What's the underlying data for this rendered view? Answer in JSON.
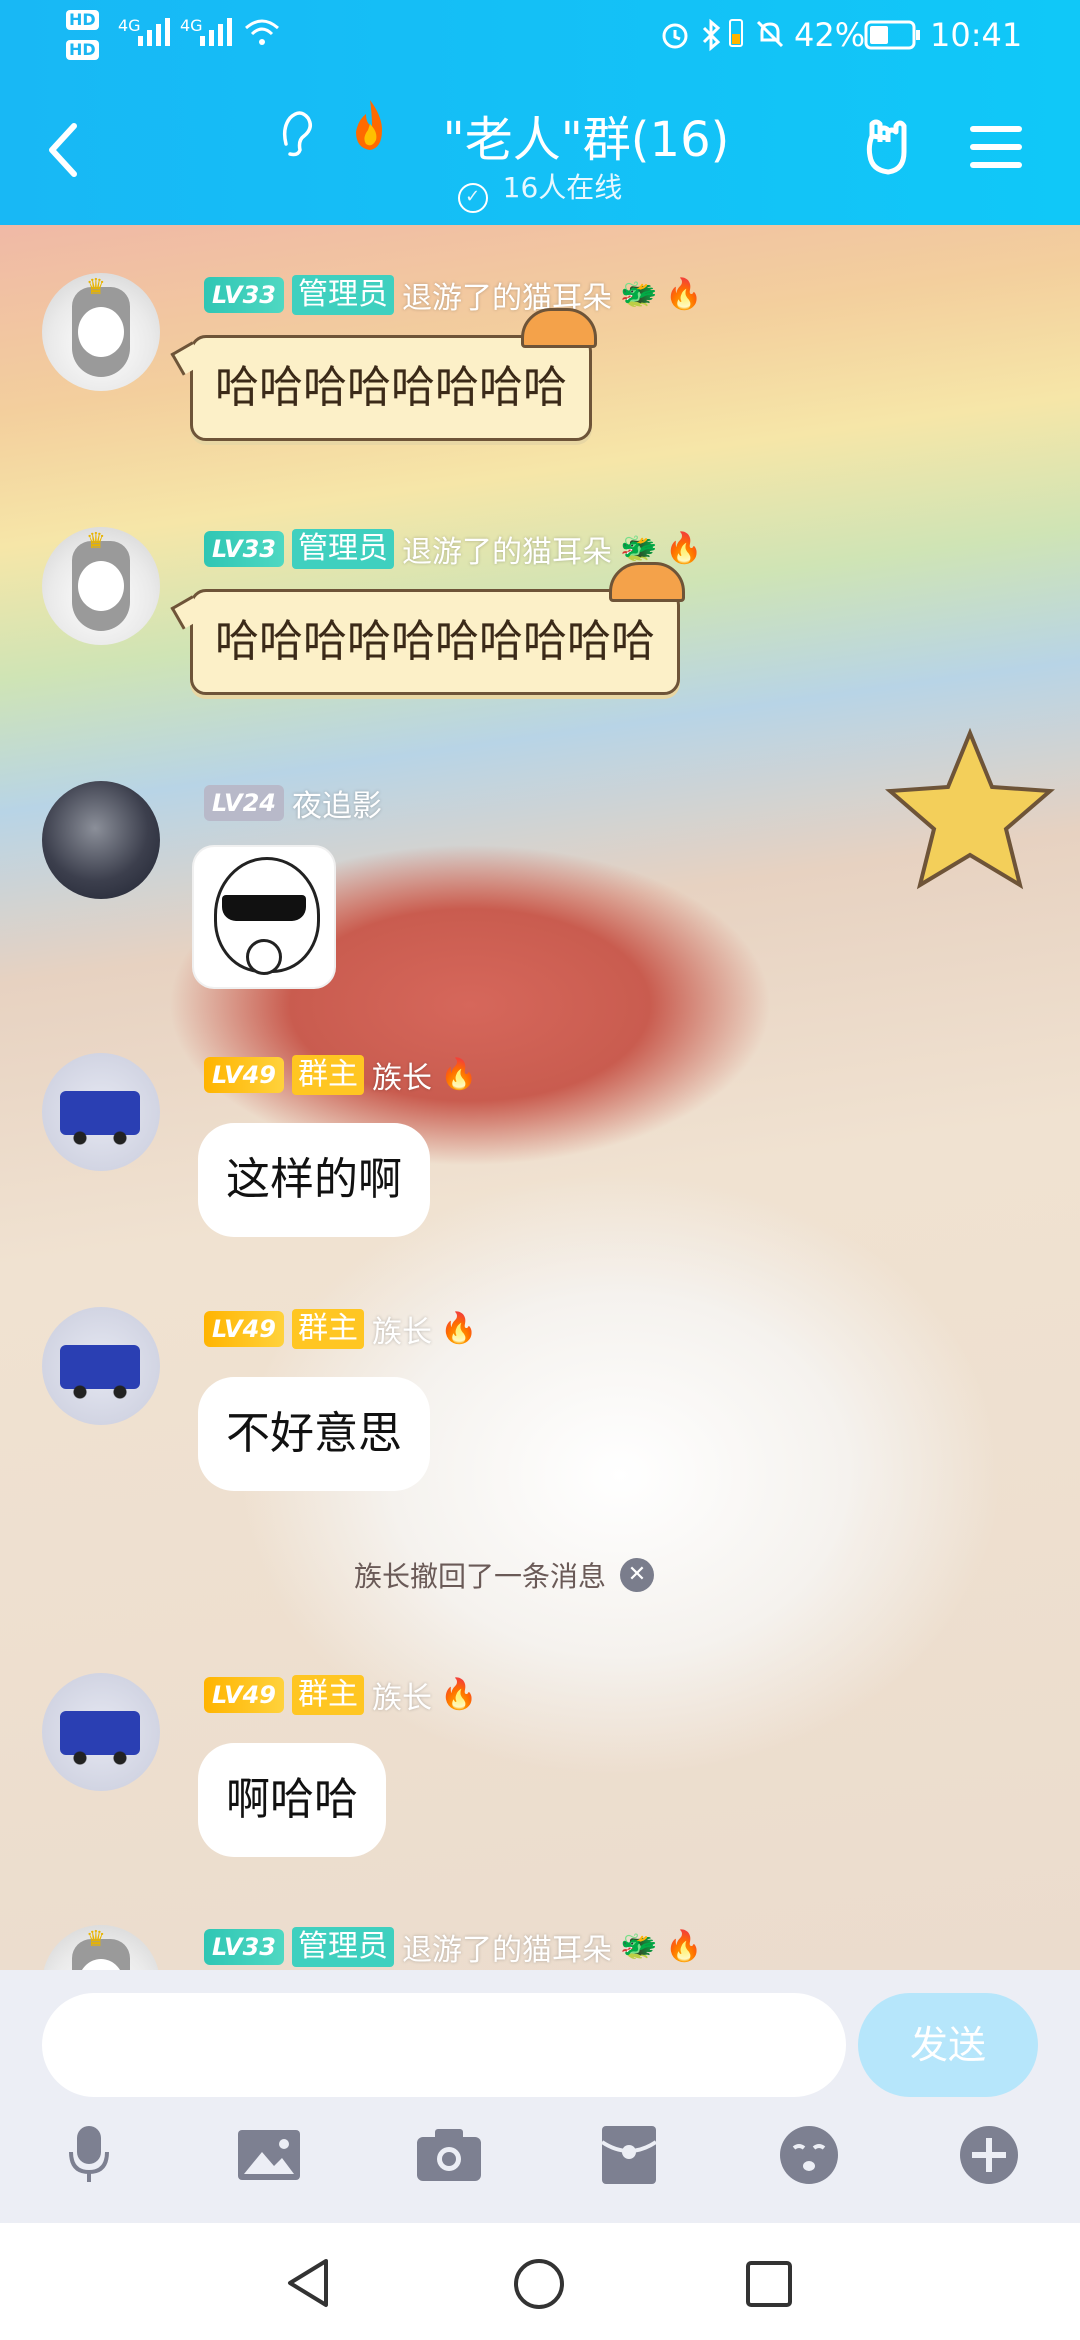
{
  "status_bar": {
    "hd1": "HD",
    "hd2": "HD",
    "net1": "4G",
    "net2": "4G",
    "battery": "42%",
    "time": "10:41"
  },
  "header": {
    "title": "\"老人\"群(16)",
    "online": "16人在线"
  },
  "messages": [
    {
      "level": "LV33",
      "role": "管理员",
      "nick": "退游了的猫耳朵",
      "text": "哈哈哈哈哈哈哈哈"
    },
    {
      "level": "LV33",
      "role": "管理员",
      "nick": "退游了的猫耳朵",
      "text": "哈哈哈哈哈哈哈哈哈哈"
    },
    {
      "level": "LV24",
      "role": "",
      "nick": "夜追影",
      "text": ""
    },
    {
      "level": "LV49",
      "role": "群主",
      "nick": "族长",
      "text": "这样的啊"
    },
    {
      "level": "LV49",
      "role": "群主",
      "nick": "族长",
      "text": "不好意思"
    },
    {
      "level": "LV49",
      "role": "群主",
      "nick": "族长",
      "text": "啊哈哈"
    },
    {
      "level": "LV33",
      "role": "管理员",
      "nick": "退游了的猫耳朵",
      "text": ""
    }
  ],
  "system_note": "族长撤回了一条消息",
  "input": {
    "placeholder": "",
    "send_label": "发送"
  },
  "colors": {
    "header": "#18b8f5",
    "admin_badge": "#3fd0bf",
    "owner_badge": "#ffc622",
    "send_button": "#b6e6fb"
  }
}
